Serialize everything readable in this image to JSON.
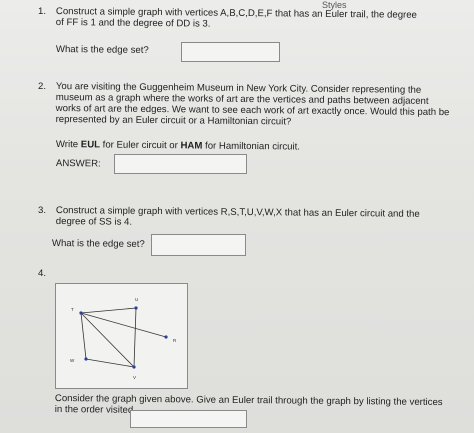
{
  "header": {
    "styles_label": "Styles"
  },
  "q1": {
    "number": "1.",
    "line1": "Construct a simple graph with vertices A,B,C,D,E,F that has an Euler trail, the degree",
    "line2": "of FF is 1 and the degree of DD is 3.",
    "prompt": "What is the edge set?",
    "answer_value": ""
  },
  "q2": {
    "number": "2.",
    "line1": "You are visiting the Guggenheim Museum in New York City. Consider representing the",
    "line2": "museum as a graph where the works of art are the vertices and paths between adjacent",
    "line3": "works of art are the edges. We want to see each work of art exactly once. Would this path be",
    "line4": "represented by an Euler circuit or a Hamiltonian circuit?",
    "instruction_prefix": "Write",
    "eul": "EUL",
    "instruction_mid": "for Euler circuit or",
    "ham": "HAM",
    "instruction_suffix": "for Hamiltonian circuit.",
    "answer_label": "ANSWER:",
    "answer_value": ""
  },
  "q3": {
    "number": "3.",
    "line1": "Construct a simple graph with vertices R,S,T,U,V,W,X that has an Euler circuit and the",
    "line2": "degree of SS is 4.",
    "prompt": "What is the edge set?",
    "answer_value": ""
  },
  "q4": {
    "number": "4.",
    "graph": {
      "vertices": [
        "T",
        "U",
        "R",
        "W",
        "V"
      ],
      "edges": [
        [
          "T",
          "U"
        ],
        [
          "T",
          "R"
        ],
        [
          "T",
          "W"
        ],
        [
          "T",
          "V"
        ],
        [
          "U",
          "V"
        ],
        [
          "W",
          "V"
        ]
      ]
    },
    "line1": "Consider the graph given above. Give an Euler trail through the graph by listing the vertices",
    "line2": "in the order visited.",
    "answer_value": ""
  }
}
